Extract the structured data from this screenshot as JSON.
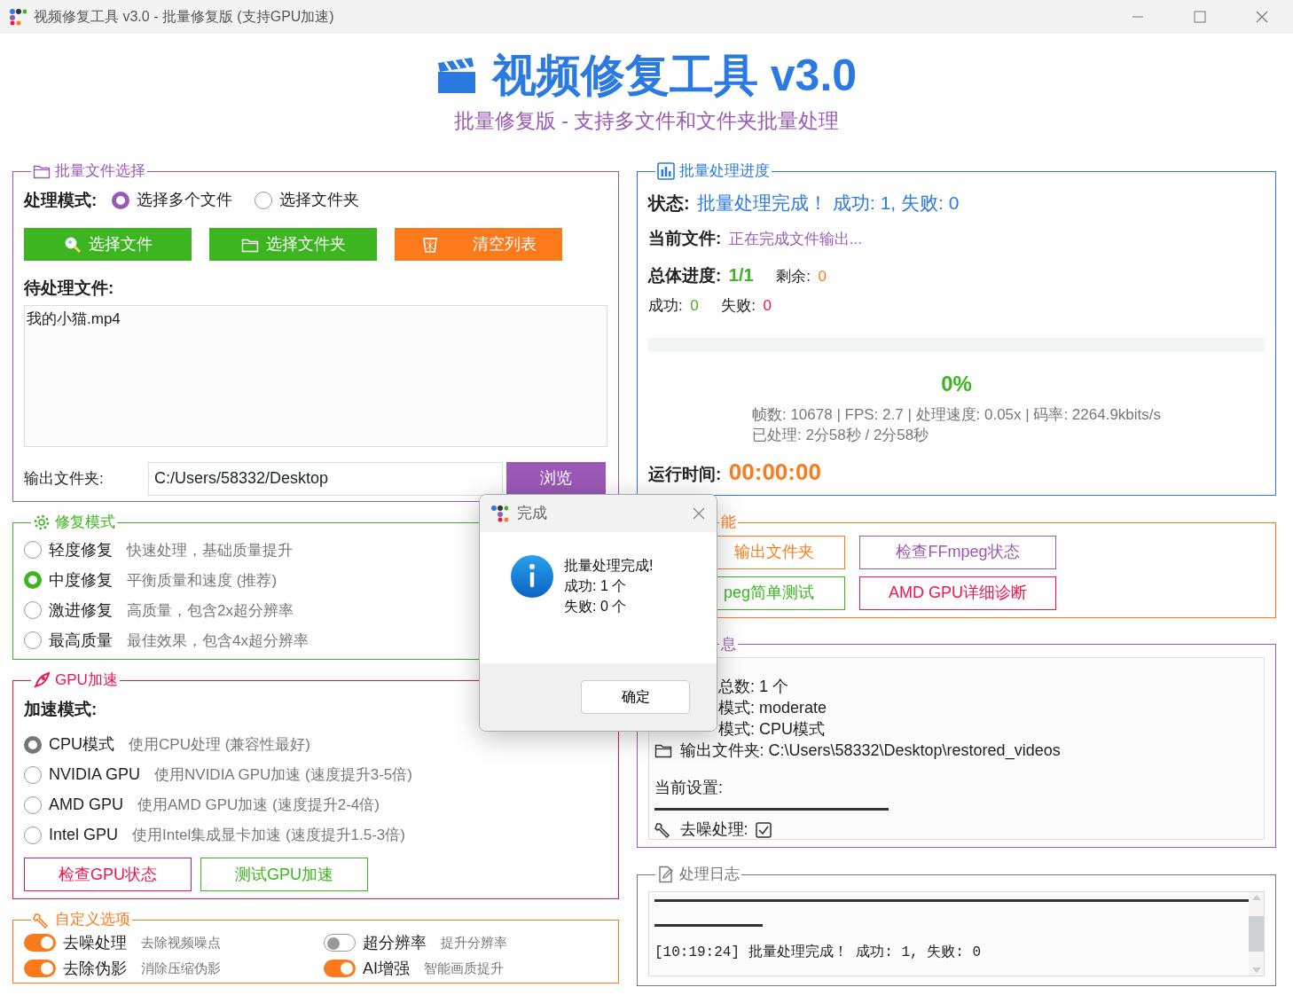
{
  "window": {
    "title": "视频修复工具 v3.0 - 批量修复版 (支持GPU加速)"
  },
  "header": {
    "title": "视频修复工具 v3.0",
    "subtitle": "批量修复版 - 支持多文件和文件夹批量处理"
  },
  "file_select": {
    "legend": "批量文件选择",
    "mode_label": "处理模式:",
    "modes": [
      {
        "label": "选择多个文件",
        "selected": true
      },
      {
        "label": "选择文件夹",
        "selected": false
      }
    ],
    "buttons": [
      {
        "label": "选择文件",
        "kind": "search",
        "color": "#3cb521"
      },
      {
        "label": "选择文件夹",
        "kind": "folder",
        "color": "#3cb521"
      },
      {
        "label": "清空列表",
        "kind": "trash",
        "color": "#fd7a1c"
      }
    ],
    "pending_label": "待处理文件:",
    "files": [
      "我的小猫.mp4"
    ],
    "output_label": "输出文件夹:",
    "output_value": "C:/Users/58332/Desktop",
    "browse": "浏览"
  },
  "repair": {
    "legend": "修复模式",
    "options": [
      {
        "label": "轻度修复",
        "desc": "快速处理，基础质量提升",
        "selected": false
      },
      {
        "label": "中度修复",
        "desc": "平衡质量和速度 (推荐)",
        "selected": true
      },
      {
        "label": "激进修复",
        "desc": "高质量，包含2x超分辨率",
        "selected": false
      },
      {
        "label": "最高质量",
        "desc": "最佳效果，包含4x超分辨率",
        "selected": false
      }
    ]
  },
  "gpu": {
    "legend": "GPU加速",
    "mode_label": "加速模式:",
    "options": [
      {
        "label": "CPU模式",
        "desc": "使用CPU处理 (兼容性最好)",
        "selected": true
      },
      {
        "label": "NVIDIA GPU",
        "desc": "使用NVIDIA GPU加速 (速度提升3-5倍)",
        "selected": false
      },
      {
        "label": "AMD GPU",
        "desc": "使用AMD GPU加速 (速度提升2-4倍)",
        "selected": false
      },
      {
        "label": "Intel GPU",
        "desc": "使用Intel集成显卡加速 (速度提升1.5-3倍)",
        "selected": false
      }
    ],
    "buttons": [
      {
        "label": "检查GPU状态",
        "color": "#f0134d"
      },
      {
        "label": "测试GPU加速",
        "color": "#3cb521"
      }
    ]
  },
  "custom": {
    "legend": "自定义选项",
    "toggles": [
      {
        "label": "去噪处理",
        "desc": "去除视频噪点",
        "on": true
      },
      {
        "label": "超分辨率",
        "desc": "提升分辨率",
        "on": false
      },
      {
        "label": "去除伪影",
        "desc": "消除压缩伪影",
        "on": true
      },
      {
        "label": "AI增强",
        "desc": "智能画质提升",
        "on": true
      }
    ]
  },
  "progress": {
    "legend": "批量处理进度",
    "status_label": "状态:",
    "status": "批量处理完成！ 成功: 1, 失败: 0",
    "current_label": "当前文件:",
    "current": "正在完成文件输出...",
    "overall_label": "总体进度:",
    "overall": "1/1",
    "remaining_label": "剩余:",
    "remaining": "0",
    "success_label": "成功:",
    "success": "0",
    "fail_label": "失败:",
    "fail": "0",
    "level": 0,
    "percent": "0%",
    "stats": [
      "帧数: 10678 | FPS: 2.7 | 处理速度: 0.05x | 码率: 2264.9kbits/s",
      "已处理: 2分58秒 / 2分58秒"
    ],
    "runtime_label": "运行时间:",
    "runtime": "00:00:00"
  },
  "quick": {
    "legend": "能",
    "buttons": [
      {
        "label": "输出文件夹",
        "color": "#fd7a1c"
      },
      {
        "label": "检查FFmpeg状态",
        "color": "#9b59b6"
      },
      {
        "label": "peg简单测试",
        "color": "#3cb521"
      },
      {
        "label": "AMD GPU详细诊断",
        "color": "#f0134d"
      }
    ]
  },
  "info": {
    "legend": "息",
    "lines": [
      {
        "kind": "summary",
        "text": "总数: 1 个"
      },
      {
        "kind": "summary",
        "text": "模式: moderate"
      },
      {
        "kind": "summary",
        "text": "模式: CPU模式"
      },
      {
        "kind": "path",
        "text": "输出文件夹: C:\\Users\\58332\\Desktop\\restored_videos"
      }
    ],
    "settings_label": "当前设置:",
    "settings": [
      {
        "label": "去噪处理:",
        "checked": true
      }
    ]
  },
  "log": {
    "legend": "处理日志",
    "lines": [
      "[10:19:24] 批量处理完成！ 成功: 1, 失败: 0"
    ]
  },
  "dialog": {
    "title": "完成",
    "message": [
      "批量处理完成!",
      "成功: 1 个",
      "失败: 0 个"
    ],
    "button": "确定"
  }
}
